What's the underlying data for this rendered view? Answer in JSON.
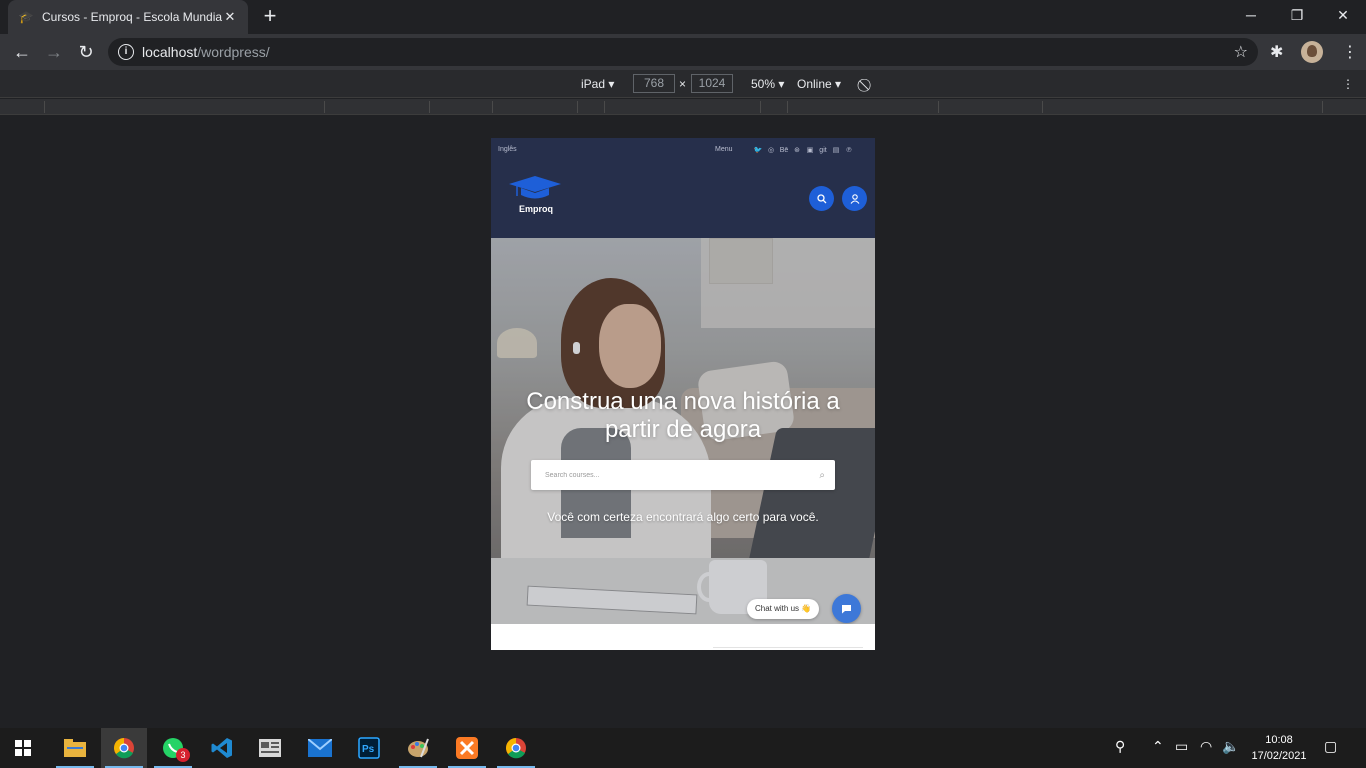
{
  "browser": {
    "tab_title": "Cursos - Emproq - Escola Mundial",
    "tab_close": "✕",
    "new_tab": "+",
    "url_host": "localhost",
    "url_path": "/wordpress/",
    "window_controls": [
      "─",
      "❐",
      "✕"
    ]
  },
  "device_toolbar": {
    "device": "iPad",
    "width": "768",
    "times": "×",
    "height": "1024",
    "zoom": "50%",
    "network": "Online"
  },
  "site": {
    "language": "Inglês",
    "menu_label": "Menu",
    "social_icons": [
      "twitter-icon",
      "instagram-icon",
      "behance-icon",
      "dribbble-icon",
      "flickr-icon",
      "github-icon",
      "linkedin-icon",
      "pinterest-icon"
    ],
    "brand_name": "Emproq",
    "brand_color": "#1e5fd8",
    "header_bg": "#262f4b",
    "hero": {
      "headline_line1": "Construa uma nova história a",
      "headline_line2": "partir de agora",
      "search_placeholder": "Search courses...",
      "subline": "Você com certeza encontrará algo certo para você."
    },
    "chat": {
      "label": "Chat with us 👋"
    }
  },
  "taskbar": {
    "apps": [
      "windows-start",
      "file-explorer",
      "chrome",
      "whatsapp",
      "vscode",
      "news",
      "mail",
      "photoshop",
      "paint",
      "xampp",
      "chrome"
    ],
    "whatsapp_badge": "3",
    "time": "10:08",
    "date": "17/02/2021"
  }
}
